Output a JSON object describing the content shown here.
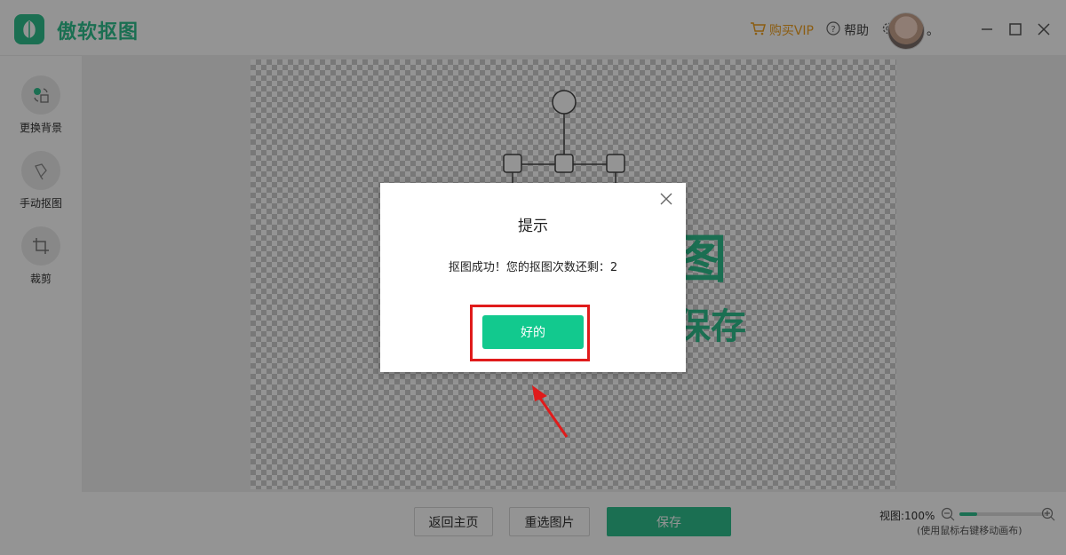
{
  "app": {
    "title": "傲软抠图",
    "brand_color": "#2fbf8d",
    "logo_icon": "leaf-icon"
  },
  "header": {
    "vip_label": "购买VIP",
    "help_label": "帮助",
    "settings_label": "设置",
    "username": "。"
  },
  "sidebar": {
    "items": [
      {
        "label": "更换背景",
        "icon": "replace-background-icon"
      },
      {
        "label": "手动抠图",
        "icon": "brush-icon"
      },
      {
        "label": "裁剪",
        "icon": "crop-icon"
      }
    ]
  },
  "canvas": {
    "text_line1": "图",
    "text_line2": "保存"
  },
  "dialog": {
    "title": "提示",
    "message": "抠图成功！您的抠图次数还剩：2",
    "ok_label": "好的",
    "ok_color": "#12c98e",
    "highlight_color": "#e01b1b"
  },
  "footer": {
    "back_label": "返回主页",
    "reselect_label": "重选图片",
    "save_label": "保存",
    "zoom_label": "视图:100%",
    "zoom_hint": "(使用鼠标右键移动画布)",
    "zoom_level": 0.2
  }
}
